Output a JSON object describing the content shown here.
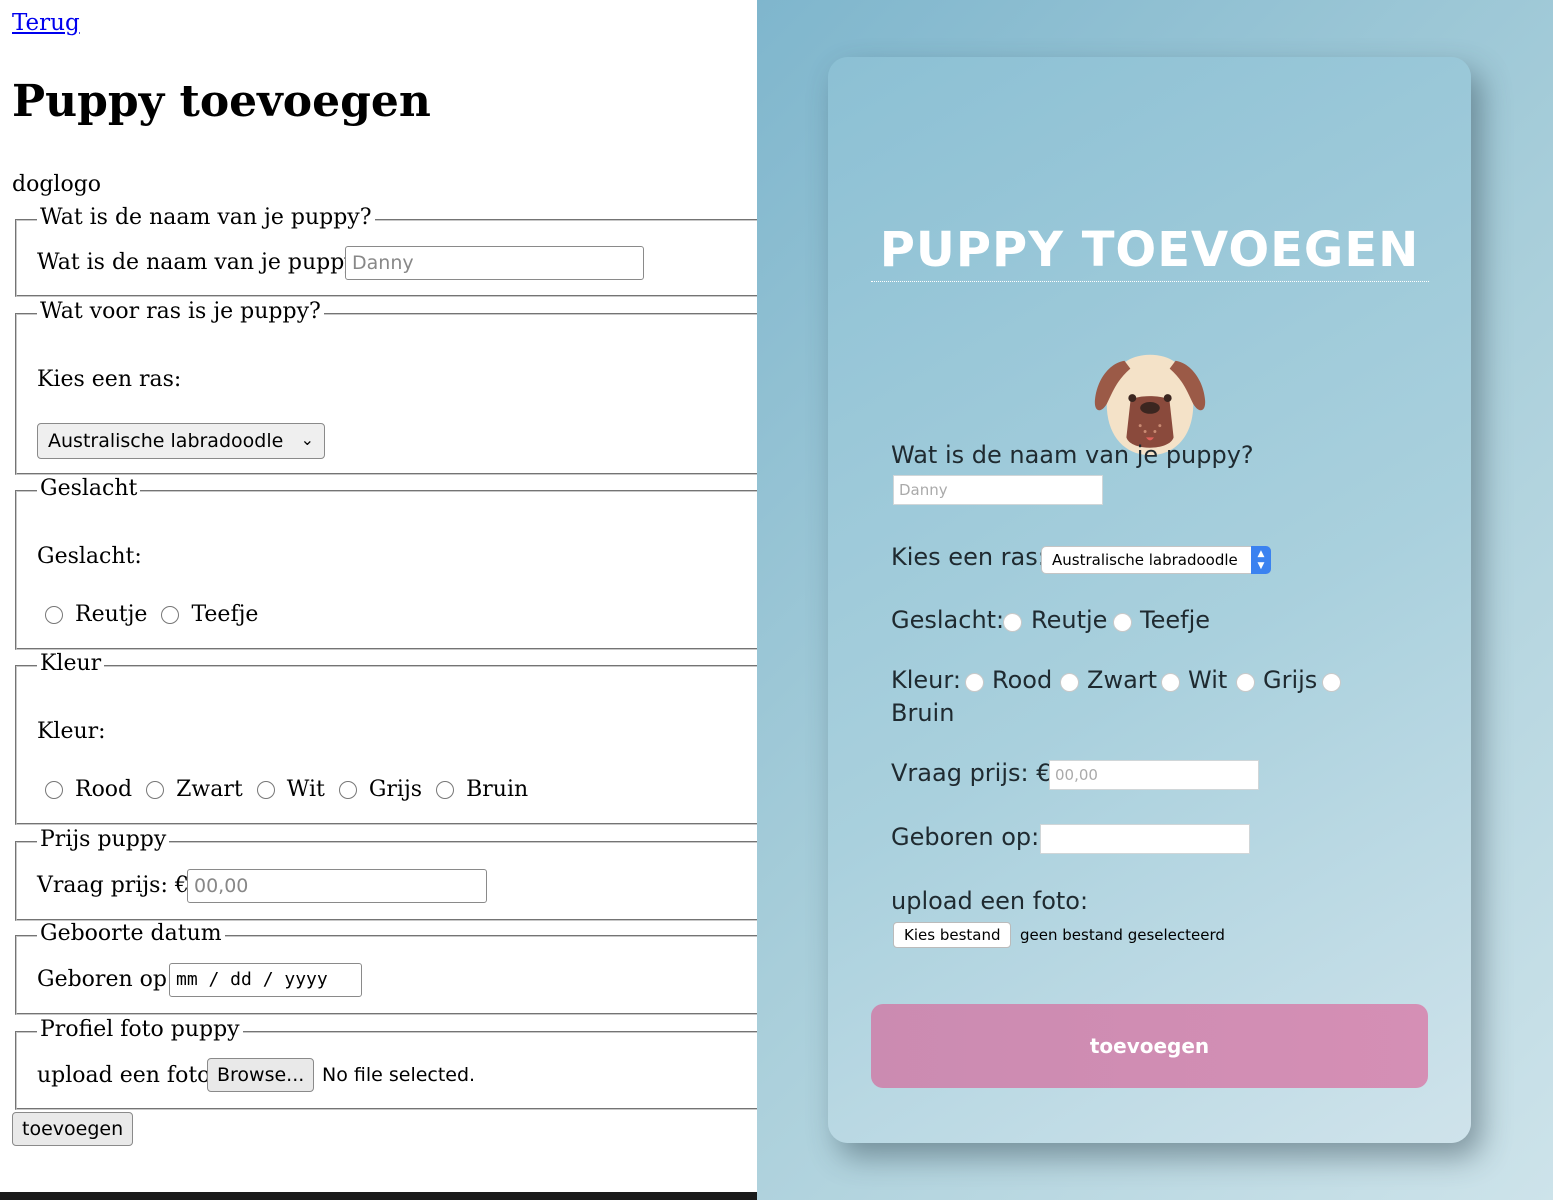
{
  "left": {
    "back_link": "Terug",
    "title": "Puppy toevoegen",
    "logo_alt": "doglogo",
    "name_section": {
      "legend": "Wat is de naam van je puppy?",
      "label": "Wat is de naam van je puppy?",
      "placeholder": "Danny"
    },
    "breed_section": {
      "legend": "Wat voor ras is je puppy?",
      "label": "Kies een ras:",
      "selected": "Australische labradoodle"
    },
    "gender_section": {
      "legend": "Geslacht",
      "label": "Geslacht:",
      "options": [
        "Reutje",
        "Teefje"
      ]
    },
    "color_section": {
      "legend": "Kleur",
      "label": "Kleur:",
      "options": [
        "Rood",
        "Zwart",
        "Wit",
        "Grijs",
        "Bruin"
      ]
    },
    "price_section": {
      "legend": "Prijs puppy",
      "label": "Vraag prijs: €",
      "placeholder": "00,00"
    },
    "birth_section": {
      "legend": "Geboorte datum",
      "label": "Geboren op:",
      "placeholder": "mm / dd / yyyy"
    },
    "photo_section": {
      "legend": "Profiel foto puppy",
      "label": "upload een foto:",
      "browse_button": "Browse...",
      "file_status": "No file selected."
    },
    "submit": "toevoegen"
  },
  "right": {
    "title": "PUPPY TOEVOEGEN",
    "name_label": "Wat is de naam van je puppy?",
    "name_placeholder": "Danny",
    "breed_label": "Kies een ras:",
    "breed_selected": "Australische labradoodle",
    "gender_label": "Geslacht:",
    "gender_options": [
      "Reutje",
      "Teefje"
    ],
    "color_label": "Kleur:",
    "color_options": [
      "Rood",
      "Zwart",
      "Wit",
      "Grijs",
      "Bruin"
    ],
    "price_label": "Vraag prijs: €",
    "price_placeholder": "00,00",
    "birth_label": "Geboren op:",
    "photo_label": "upload een foto:",
    "file_button": "Kies bestand",
    "file_status": "geen bestand geselecteerd",
    "submit": "toevoegen",
    "dog_icon": "dog-face-icon",
    "submit_color": "#d18db3"
  }
}
